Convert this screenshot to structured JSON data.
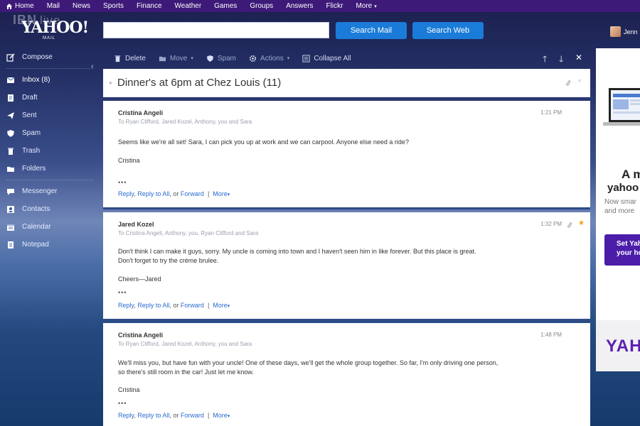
{
  "topnav": {
    "items": [
      "Home",
      "Mail",
      "News",
      "Sports",
      "Finance",
      "Weather",
      "Games",
      "Groups",
      "Answers",
      "Flickr",
      "More"
    ]
  },
  "watermark": {
    "brand": "IBN",
    "live": "live"
  },
  "header": {
    "logo": "YAHOO!",
    "logo_sub": "MAIL",
    "search_placeholder": "",
    "search_mail_label": "Search Mail",
    "search_web_label": "Search Web",
    "user_name": "Jenn"
  },
  "sidebar": {
    "compose": "Compose",
    "folders": [
      {
        "label": "Inbox (8)",
        "icon": "inbox-icon"
      },
      {
        "label": "Draft",
        "icon": "draft-icon"
      },
      {
        "label": "Sent",
        "icon": "sent-icon"
      },
      {
        "label": "Spam",
        "icon": "spam-icon"
      },
      {
        "label": "Trash",
        "icon": "trash-icon"
      },
      {
        "label": "Folders",
        "icon": "folder-icon"
      }
    ],
    "apps": [
      {
        "label": "Messenger",
        "icon": "messenger-icon"
      },
      {
        "label": "Contacts",
        "icon": "contacts-icon"
      },
      {
        "label": "Calendar",
        "icon": "calendar-icon"
      },
      {
        "label": "Notepad",
        "icon": "notepad-icon"
      }
    ]
  },
  "toolbar": {
    "delete": "Delete",
    "move": "Move",
    "spam": "Spam",
    "actions": "Actions",
    "collapse_all": "Collapse All"
  },
  "conversation": {
    "subject": "Dinner's at 6pm at Chez Louis (11)"
  },
  "messages": [
    {
      "from": "Cristina Angeli",
      "to": "To Ryan Clifford, Jared Kozel, Anthony, you and Sara",
      "time": "1:21 PM",
      "body": [
        "Seems like we're all set! Sara, I can pick you up at work and we can carpool. Anyone else need a ride?",
        "",
        "Cristina"
      ],
      "ellipsis": "•••",
      "reply": "Reply",
      "reply_all": "Reply to All",
      "or": ", or",
      "forward": "Forward",
      "more": "More"
    },
    {
      "from": "Jared Kozel",
      "to": "To Cristina Angeli, Anthony, you, Ryan Clifford and Sara",
      "time": "1:32 PM",
      "body": [
        "Don't think I can make it guys, sorry. My uncle is coming into town and I haven't seen him in like forever. But this place is great.",
        "Don't forget to try the crème brulee.",
        "",
        "Cheers—Jared"
      ],
      "ellipsis": "•••",
      "reply": "Reply",
      "reply_all": "Reply to All",
      "or": ", or",
      "forward": "Forward",
      "more": "More"
    },
    {
      "from": "Cristina Angeli",
      "to": "To Ryan Clifford, Jared Kozel, Anthony, you and Sara",
      "time": "1:48 PM",
      "body": [
        "We'll miss you, but have fun with your uncle! One of these days, we'll get the whole group together.  So far, I'm only driving one person,",
        "so there's still room in the car!  Just let me know.",
        "",
        "Cristina"
      ],
      "ellipsis": "•••",
      "reply": "Reply",
      "reply_all": "Reply to All",
      "or": ", or",
      "forward": "Forward",
      "more": "More"
    }
  ],
  "ad": {
    "headline1": "A m",
    "headline2": "yahoo",
    "sub1": "Now smar",
    "sub2": "and more",
    "cta1": "Set Yah",
    "cta2": "your ho",
    "brand": "YAH"
  },
  "colors": {
    "topnav_bg": "#3d1a78",
    "button_blue": "#1b7bd8",
    "link_blue": "#2a6bd0",
    "star": "#f39c12",
    "ad_purple": "#4b1da8"
  }
}
